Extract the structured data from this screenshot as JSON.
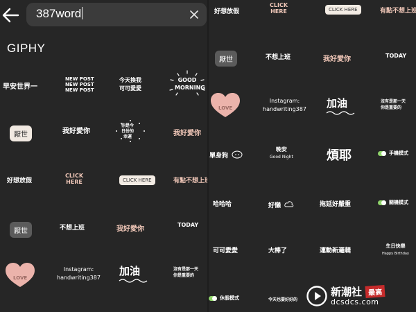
{
  "search": {
    "query": "387word"
  },
  "brand": {
    "label": "GIPHY"
  },
  "left_stickers": [
    {
      "text": "早安世界一"
    },
    {
      "lines": [
        "NEW POST",
        "NEW POST",
        "NEW POST"
      ]
    },
    {
      "lines": [
        "今天換我",
        "可可愛愛"
      ]
    },
    {
      "lines": [
        "GOOD",
        "MORNING"
      ]
    },
    {
      "text": "厭世"
    },
    {
      "text": "我好愛你"
    },
    {
      "lines": [
        "你是今",
        "日份的",
        "幸運"
      ]
    },
    {
      "text": "我好愛你"
    },
    {
      "text": "好想放假"
    },
    {
      "lines": [
        "CLICK",
        "HERE"
      ]
    },
    {
      "text": "CLICK HERE"
    },
    {
      "text": "有點不想上班"
    },
    {
      "text": "厭世"
    },
    {
      "text": "不想上班"
    },
    {
      "text": "我好愛你"
    },
    {
      "text": "TODAY"
    },
    {
      "text": "LOVE"
    },
    {
      "lines": [
        "Instagram:",
        "handwriting387"
      ]
    },
    {
      "text": "加油"
    },
    {
      "lines": [
        "沒有是那一天",
        "你是重要的"
      ]
    }
  ],
  "right_stickers": [
    {
      "text": "好想放假"
    },
    {
      "lines": [
        "CLICK",
        "HERE"
      ]
    },
    {
      "text": "CLICK HERE"
    },
    {
      "text": "有點不想上班"
    },
    {
      "text": "厭世"
    },
    {
      "text": "不想上班"
    },
    {
      "text": "我好愛你"
    },
    {
      "text": "TODAY"
    },
    {
      "text": "LOVE"
    },
    {
      "lines": [
        "Instagram:",
        "handwriting387"
      ]
    },
    {
      "text": "加油"
    },
    {
      "lines": [
        "沒有是那一天",
        "你是重要的"
      ]
    },
    {
      "text": "單身狗"
    },
    {
      "lines": [
        "晚安",
        "Good Night"
      ]
    },
    {
      "text": "煩耶"
    },
    {
      "text": "手機模式"
    },
    {
      "text": "哈哈哈"
    },
    {
      "text": "好懶"
    },
    {
      "text": "拖延好嚴重"
    },
    {
      "text": "關機模式"
    },
    {
      "text": "可可愛愛"
    },
    {
      "text": "大棒了"
    },
    {
      "text": "運動新邏輯"
    },
    {
      "lines": [
        "生日快樂",
        "Happy Birthday"
      ]
    },
    {
      "text": "休假模式"
    },
    {
      "text": "今天也要好好的"
    }
  ],
  "watermark": {
    "cn": "新潮社",
    "tag": "最高",
    "url": "dcsdcs.com"
  },
  "colors": {
    "background": "#262626",
    "heart": "#ebb3ab",
    "toggle": "#8fd46a"
  }
}
